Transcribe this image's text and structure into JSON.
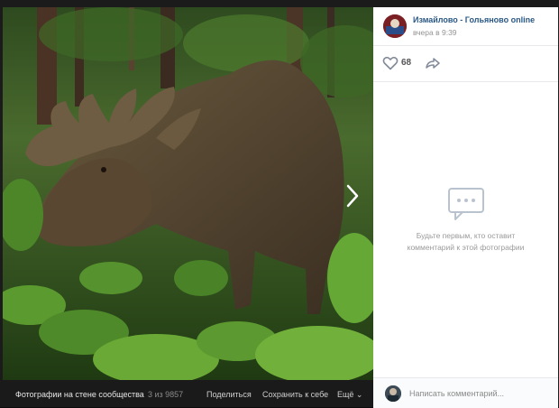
{
  "post": {
    "group_name": "Измайлово - Гольяново online",
    "time": "вчера в 9:39",
    "likes": "68"
  },
  "photo_bar": {
    "title": "Фотографии на стене сообщества",
    "counter": "3 из 9857",
    "share": "Поделиться",
    "save": "Сохранить к себе",
    "more": "Ещё ⌄"
  },
  "comments": {
    "empty_line1": "Будьте первым, кто оставит",
    "empty_line2": "комментарий к этой фотографии",
    "placeholder": "Написать комментарий..."
  },
  "icons": {
    "like": "heart-icon",
    "share": "share-arrow-icon",
    "next": "chevron-right-icon",
    "empty_comments": "comment-bubble-icon"
  },
  "colors": {
    "link": "#2a5885",
    "panel_bg": "#ffffff",
    "viewer_bg": "#1b1b1b"
  }
}
